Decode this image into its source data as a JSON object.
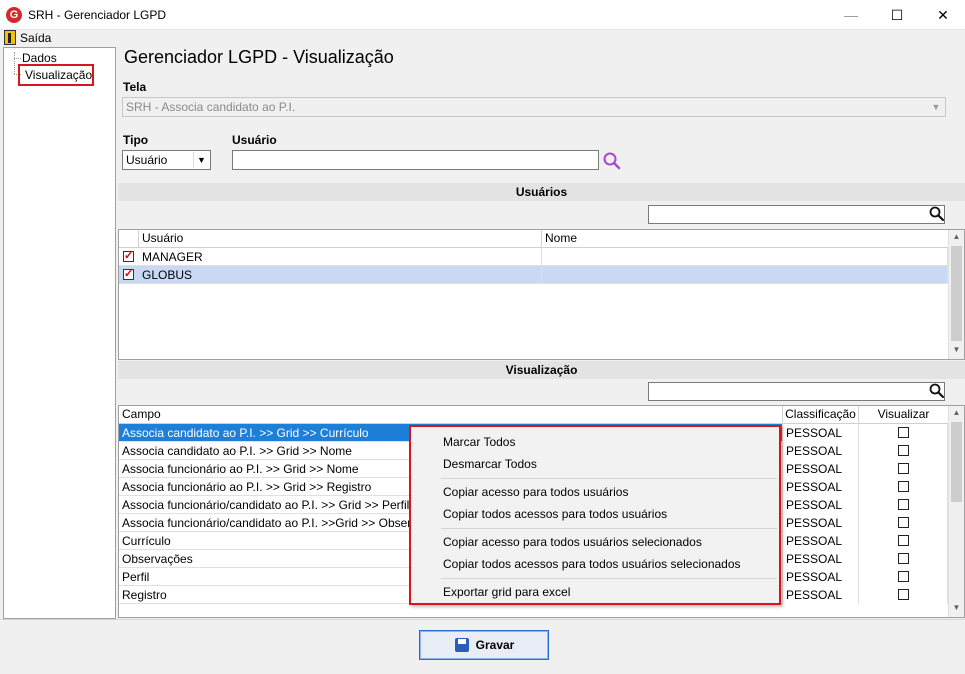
{
  "window": {
    "title": "SRH - Gerenciador LGPD",
    "app_icon": "G",
    "minimize_icon": "—",
    "maximize_icon": "☐",
    "close_icon": "✕"
  },
  "menu": {
    "exit_label": "Saída"
  },
  "tree": {
    "items": [
      {
        "label": "Dados"
      },
      {
        "label": "Visualização",
        "selected": true
      }
    ]
  },
  "page": {
    "title": "Gerenciador LGPD - Visualização"
  },
  "form": {
    "tela_label": "Tela",
    "tela_value": "SRH - Associa candidato ao P.I.",
    "tipo_label": "Tipo",
    "tipo_value": "Usuário",
    "usuario_label": "Usuário",
    "usuario_value": ""
  },
  "users_section": {
    "title": "Usuários",
    "search_value": "",
    "columns": [
      "Usuário",
      "Nome"
    ],
    "rows": [
      {
        "usuario": "MANAGER",
        "nome": "",
        "checked": true,
        "selected": false
      },
      {
        "usuario": "GLOBUS",
        "nome": "",
        "checked": true,
        "selected": true
      }
    ]
  },
  "vis_section": {
    "title": "Visualização",
    "search_value": "",
    "columns": [
      "Campo",
      "Classificação",
      "Visualizar"
    ],
    "rows": [
      {
        "campo": "Associa candidato ao P.I. >> Grid >> Currículo",
        "classificacao": "PESSOAL",
        "visualizar": false,
        "selected": true
      },
      {
        "campo": "Associa candidato ao P.I. >> Grid >> Nome",
        "classificacao": "PESSOAL",
        "visualizar": false,
        "selected": false
      },
      {
        "campo": "Associa funcionário ao P.I. >> Grid >> Nome",
        "classificacao": "PESSOAL",
        "visualizar": false,
        "selected": false
      },
      {
        "campo": "Associa funcionário ao P.I. >> Grid >> Registro",
        "classificacao": "PESSOAL",
        "visualizar": false,
        "selected": false
      },
      {
        "campo": "Associa funcionário/candidato ao P.I. >> Grid >> Perfil",
        "classificacao": "PESSOAL",
        "visualizar": false,
        "selected": false
      },
      {
        "campo": "Associa funcionário/candidato ao P.I. >>Grid >> Observações",
        "classificacao": "PESSOAL",
        "visualizar": false,
        "selected": false
      },
      {
        "campo": "Currículo",
        "classificacao": "PESSOAL",
        "visualizar": false,
        "selected": false
      },
      {
        "campo": "Observações",
        "classificacao": "PESSOAL",
        "visualizar": false,
        "selected": false
      },
      {
        "campo": "Perfil",
        "classificacao": "PESSOAL",
        "visualizar": false,
        "selected": false
      },
      {
        "campo": "Registro",
        "classificacao": "PESSOAL",
        "visualizar": false,
        "selected": false
      }
    ]
  },
  "context_menu": {
    "groups": [
      [
        "Marcar Todos",
        "Desmarcar Todos"
      ],
      [
        "Copiar acesso para todos usuários",
        "Copiar todos acessos para todos usuários"
      ],
      [
        "Copiar acesso para todos usuários selecionados",
        "Copiar todos acessos para todos usuários selecionados"
      ],
      [
        "Exportar grid para excel"
      ]
    ]
  },
  "footer": {
    "save_label": "Gravar"
  },
  "colors": {
    "accent": "#1e7fd8",
    "highlight_border": "#d9141c",
    "selected_row": "#c9d9f5"
  }
}
